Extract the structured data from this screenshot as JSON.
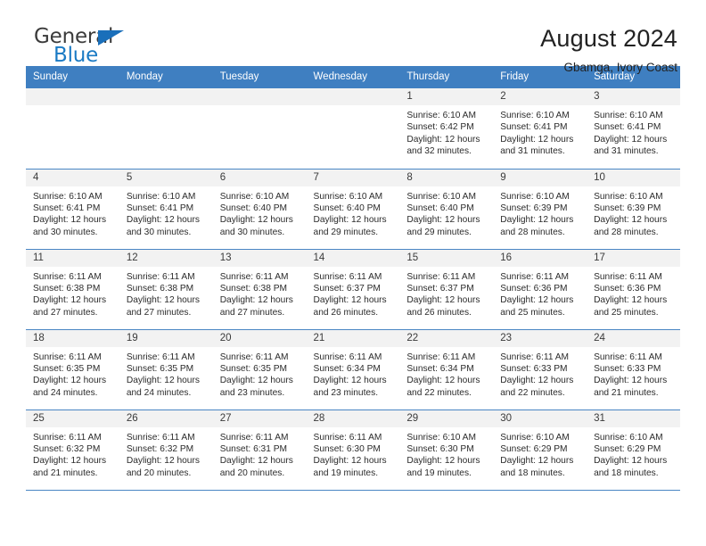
{
  "brand": {
    "name_top": "General",
    "name_bottom": "Blue",
    "triangle_color": "#1a6fba",
    "blue_text_color": "#1a7ac4"
  },
  "header": {
    "title": "August 2024",
    "subtitle": "Gbamga, Ivory Coast"
  },
  "theme": {
    "header_bg": "#3f7fc1",
    "header_text": "#ffffff",
    "daynum_band_bg": "#f2f2f2",
    "row_rule": "#4a86c4",
    "body_text": "#2b2b2b"
  },
  "labels": {
    "sunrise_prefix": "Sunrise:",
    "sunset_prefix": "Sunset:",
    "daylight_prefix": "Daylight:"
  },
  "columns": [
    "Sunday",
    "Monday",
    "Tuesday",
    "Wednesday",
    "Thursday",
    "Friday",
    "Saturday"
  ],
  "weeks": [
    [
      {
        "day": "",
        "empty": true
      },
      {
        "day": "",
        "empty": true
      },
      {
        "day": "",
        "empty": true
      },
      {
        "day": "",
        "empty": true
      },
      {
        "day": "1",
        "sunrise": "Sunrise: 6:10 AM",
        "sunset": "Sunset: 6:42 PM",
        "daylight": "Daylight: 12 hours and 32 minutes."
      },
      {
        "day": "2",
        "sunrise": "Sunrise: 6:10 AM",
        "sunset": "Sunset: 6:41 PM",
        "daylight": "Daylight: 12 hours and 31 minutes."
      },
      {
        "day": "3",
        "sunrise": "Sunrise: 6:10 AM",
        "sunset": "Sunset: 6:41 PM",
        "daylight": "Daylight: 12 hours and 31 minutes."
      }
    ],
    [
      {
        "day": "4",
        "sunrise": "Sunrise: 6:10 AM",
        "sunset": "Sunset: 6:41 PM",
        "daylight": "Daylight: 12 hours and 30 minutes."
      },
      {
        "day": "5",
        "sunrise": "Sunrise: 6:10 AM",
        "sunset": "Sunset: 6:41 PM",
        "daylight": "Daylight: 12 hours and 30 minutes."
      },
      {
        "day": "6",
        "sunrise": "Sunrise: 6:10 AM",
        "sunset": "Sunset: 6:40 PM",
        "daylight": "Daylight: 12 hours and 30 minutes."
      },
      {
        "day": "7",
        "sunrise": "Sunrise: 6:10 AM",
        "sunset": "Sunset: 6:40 PM",
        "daylight": "Daylight: 12 hours and 29 minutes."
      },
      {
        "day": "8",
        "sunrise": "Sunrise: 6:10 AM",
        "sunset": "Sunset: 6:40 PM",
        "daylight": "Daylight: 12 hours and 29 minutes."
      },
      {
        "day": "9",
        "sunrise": "Sunrise: 6:10 AM",
        "sunset": "Sunset: 6:39 PM",
        "daylight": "Daylight: 12 hours and 28 minutes."
      },
      {
        "day": "10",
        "sunrise": "Sunrise: 6:10 AM",
        "sunset": "Sunset: 6:39 PM",
        "daylight": "Daylight: 12 hours and 28 minutes."
      }
    ],
    [
      {
        "day": "11",
        "sunrise": "Sunrise: 6:11 AM",
        "sunset": "Sunset: 6:38 PM",
        "daylight": "Daylight: 12 hours and 27 minutes."
      },
      {
        "day": "12",
        "sunrise": "Sunrise: 6:11 AM",
        "sunset": "Sunset: 6:38 PM",
        "daylight": "Daylight: 12 hours and 27 minutes."
      },
      {
        "day": "13",
        "sunrise": "Sunrise: 6:11 AM",
        "sunset": "Sunset: 6:38 PM",
        "daylight": "Daylight: 12 hours and 27 minutes."
      },
      {
        "day": "14",
        "sunrise": "Sunrise: 6:11 AM",
        "sunset": "Sunset: 6:37 PM",
        "daylight": "Daylight: 12 hours and 26 minutes."
      },
      {
        "day": "15",
        "sunrise": "Sunrise: 6:11 AM",
        "sunset": "Sunset: 6:37 PM",
        "daylight": "Daylight: 12 hours and 26 minutes."
      },
      {
        "day": "16",
        "sunrise": "Sunrise: 6:11 AM",
        "sunset": "Sunset: 6:36 PM",
        "daylight": "Daylight: 12 hours and 25 minutes."
      },
      {
        "day": "17",
        "sunrise": "Sunrise: 6:11 AM",
        "sunset": "Sunset: 6:36 PM",
        "daylight": "Daylight: 12 hours and 25 minutes."
      }
    ],
    [
      {
        "day": "18",
        "sunrise": "Sunrise: 6:11 AM",
        "sunset": "Sunset: 6:35 PM",
        "daylight": "Daylight: 12 hours and 24 minutes."
      },
      {
        "day": "19",
        "sunrise": "Sunrise: 6:11 AM",
        "sunset": "Sunset: 6:35 PM",
        "daylight": "Daylight: 12 hours and 24 minutes."
      },
      {
        "day": "20",
        "sunrise": "Sunrise: 6:11 AM",
        "sunset": "Sunset: 6:35 PM",
        "daylight": "Daylight: 12 hours and 23 minutes."
      },
      {
        "day": "21",
        "sunrise": "Sunrise: 6:11 AM",
        "sunset": "Sunset: 6:34 PM",
        "daylight": "Daylight: 12 hours and 23 minutes."
      },
      {
        "day": "22",
        "sunrise": "Sunrise: 6:11 AM",
        "sunset": "Sunset: 6:34 PM",
        "daylight": "Daylight: 12 hours and 22 minutes."
      },
      {
        "day": "23",
        "sunrise": "Sunrise: 6:11 AM",
        "sunset": "Sunset: 6:33 PM",
        "daylight": "Daylight: 12 hours and 22 minutes."
      },
      {
        "day": "24",
        "sunrise": "Sunrise: 6:11 AM",
        "sunset": "Sunset: 6:33 PM",
        "daylight": "Daylight: 12 hours and 21 minutes."
      }
    ],
    [
      {
        "day": "25",
        "sunrise": "Sunrise: 6:11 AM",
        "sunset": "Sunset: 6:32 PM",
        "daylight": "Daylight: 12 hours and 21 minutes."
      },
      {
        "day": "26",
        "sunrise": "Sunrise: 6:11 AM",
        "sunset": "Sunset: 6:32 PM",
        "daylight": "Daylight: 12 hours and 20 minutes."
      },
      {
        "day": "27",
        "sunrise": "Sunrise: 6:11 AM",
        "sunset": "Sunset: 6:31 PM",
        "daylight": "Daylight: 12 hours and 20 minutes."
      },
      {
        "day": "28",
        "sunrise": "Sunrise: 6:11 AM",
        "sunset": "Sunset: 6:30 PM",
        "daylight": "Daylight: 12 hours and 19 minutes."
      },
      {
        "day": "29",
        "sunrise": "Sunrise: 6:10 AM",
        "sunset": "Sunset: 6:30 PM",
        "daylight": "Daylight: 12 hours and 19 minutes."
      },
      {
        "day": "30",
        "sunrise": "Sunrise: 6:10 AM",
        "sunset": "Sunset: 6:29 PM",
        "daylight": "Daylight: 12 hours and 18 minutes."
      },
      {
        "day": "31",
        "sunrise": "Sunrise: 6:10 AM",
        "sunset": "Sunset: 6:29 PM",
        "daylight": "Daylight: 12 hours and 18 minutes."
      }
    ]
  ]
}
